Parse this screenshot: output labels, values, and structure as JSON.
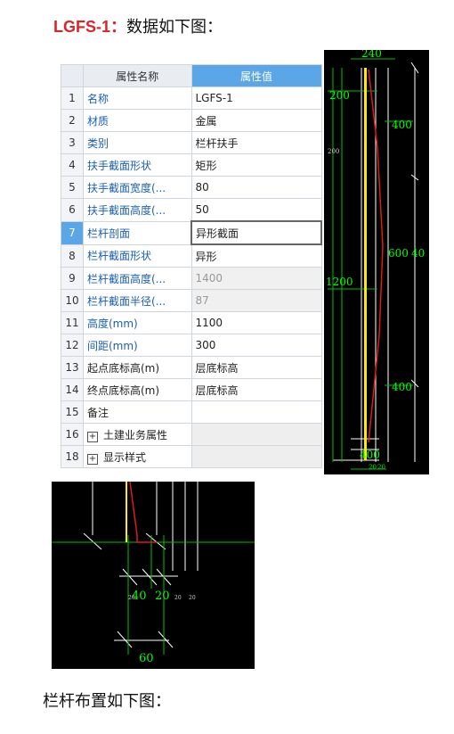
{
  "heading": {
    "tag": "LGFS-1：",
    "text": "数据如下图："
  },
  "table": {
    "col_name": "属性名称",
    "col_value": "属性值",
    "rows": [
      {
        "no": "1",
        "name": "名称",
        "value": "LGFS-1"
      },
      {
        "no": "2",
        "name": "材质",
        "value": "金属"
      },
      {
        "no": "3",
        "name": "类别",
        "value": "栏杆扶手"
      },
      {
        "no": "4",
        "name": "扶手截面形状",
        "value": "矩形"
      },
      {
        "no": "5",
        "name": "扶手截面宽度(...",
        "value": "80"
      },
      {
        "no": "6",
        "name": "扶手截面高度(...",
        "value": "50"
      },
      {
        "no": "7",
        "name": "栏杆剖面",
        "value": "异形截面"
      },
      {
        "no": "8",
        "name": "栏杆截面形状",
        "value": "异形"
      },
      {
        "no": "9",
        "name": "栏杆截面高度(...",
        "value": "1400"
      },
      {
        "no": "10",
        "name": "栏杆截面半径(...",
        "value": "87"
      },
      {
        "no": "11",
        "name": "高度(mm)",
        "value": "1100"
      },
      {
        "no": "12",
        "name": "间距(mm)",
        "value": "300"
      },
      {
        "no": "13",
        "name": "起点底标高(m)",
        "value": "层底标高"
      },
      {
        "no": "14",
        "name": "终点底标高(m)",
        "value": "层底标高"
      },
      {
        "no": "15",
        "name": "备注",
        "value": ""
      },
      {
        "no": "16",
        "name": "土建业务属性",
        "value": ""
      },
      {
        "no": "18",
        "name": "显示样式",
        "value": ""
      }
    ]
  },
  "cad_elevation": {
    "top_label": "240",
    "left_200": "200",
    "right_400_top": "400",
    "small_200": "200",
    "right_600": "600",
    "right_40": "40",
    "left_1200": "1200",
    "right_400_bottom": "400",
    "bottom_400": "400",
    "bottom_small": "20",
    "bottom_2": "20"
  },
  "cad_section": {
    "dim_40": "40",
    "dim_20": "20",
    "dim_small_20a": "20",
    "dim_small_20b": "20",
    "dim_small_20c": "20",
    "dim_60": "60"
  },
  "footer": "栏杆布置如下图："
}
